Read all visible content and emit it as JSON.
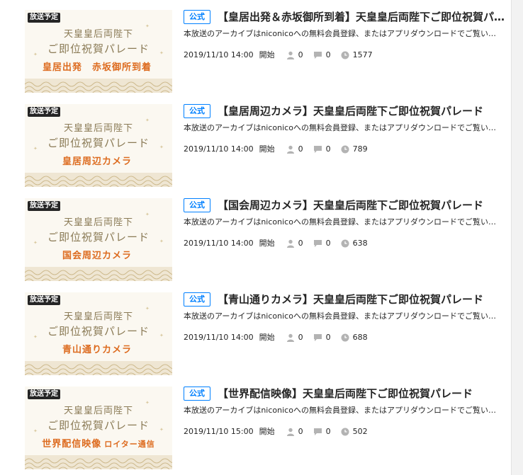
{
  "colors": {
    "official_blue": "#0080ff",
    "badge_bg": "#252525",
    "thumb_orange": "#dd6b1f",
    "thumb_gold": "#8a7a55",
    "meta_icon": "#b3b3b3"
  },
  "programs": [
    {
      "badge": "放送予定",
      "thumb_line1": "天皇皇后両陛下",
      "thumb_line2": "ご即位祝賀パレード",
      "thumb_line3": "皇居出発　赤坂御所到着",
      "thumb_line3_sub": "",
      "official": "公式",
      "title": "【皇居出発＆赤坂御所到着】天皇皇后両陛下ご即位祝賀パレード",
      "description": "本放送のアーカイブはniconicoへの無料会員登録、またはアプリダウンロードでご覧いただけます。",
      "date": "2019/11/10 14:00",
      "start_label": "開始",
      "viewers": "0",
      "comments": "0",
      "reservations": "1577",
      "icons": [
        "person-icon",
        "comment-icon",
        "clock-icon"
      ]
    },
    {
      "badge": "放送予定",
      "thumb_line1": "天皇皇后両陛下",
      "thumb_line2": "ご即位祝賀パレード",
      "thumb_line3": "皇居周辺カメラ",
      "thumb_line3_sub": "",
      "official": "公式",
      "title": "【皇居周辺カメラ】天皇皇后両陛下ご即位祝賀パレード",
      "description": "本放送のアーカイブはniconicoへの無料会員登録、またはアプリダウンロードでご覧いただけます。",
      "date": "2019/11/10 14:00",
      "start_label": "開始",
      "viewers": "0",
      "comments": "0",
      "reservations": "789",
      "icons": [
        "person-icon",
        "comment-icon",
        "clock-icon"
      ]
    },
    {
      "badge": "放送予定",
      "thumb_line1": "天皇皇后両陛下",
      "thumb_line2": "ご即位祝賀パレード",
      "thumb_line3": "国会周辺カメラ",
      "thumb_line3_sub": "",
      "official": "公式",
      "title": "【国会周辺カメラ】天皇皇后両陛下ご即位祝賀パレード",
      "description": "本放送のアーカイブはniconicoへの無料会員登録、またはアプリダウンロードでご覧いただけます。",
      "date": "2019/11/10 14:00",
      "start_label": "開始",
      "viewers": "0",
      "comments": "0",
      "reservations": "638",
      "icons": [
        "person-icon",
        "comment-icon",
        "clock-icon"
      ]
    },
    {
      "badge": "放送予定",
      "thumb_line1": "天皇皇后両陛下",
      "thumb_line2": "ご即位祝賀パレード",
      "thumb_line3": "青山通りカメラ",
      "thumb_line3_sub": "",
      "official": "公式",
      "title": "【青山通りカメラ】天皇皇后両陛下ご即位祝賀パレード",
      "description": "本放送のアーカイブはniconicoへの無料会員登録、またはアプリダウンロードでご覧いただけます。",
      "date": "2019/11/10 14:00",
      "start_label": "開始",
      "viewers": "0",
      "comments": "0",
      "reservations": "688",
      "icons": [
        "person-icon",
        "comment-icon",
        "clock-icon"
      ]
    },
    {
      "badge": "放送予定",
      "thumb_line1": "天皇皇后両陛下",
      "thumb_line2": "ご即位祝賀パレード",
      "thumb_line3": "世界配信映像",
      "thumb_line3_sub": "ロイター通信",
      "official": "公式",
      "title": "【世界配信映像】天皇皇后両陛下ご即位祝賀パレード",
      "description": "本放送のアーカイブはniconicoへの無料会員登録、またはアプリダウンロードでご覧いただけます。",
      "date": "2019/11/10 15:00",
      "start_label": "開始",
      "viewers": "0",
      "comments": "0",
      "reservations": "502",
      "icons": [
        "person-icon",
        "comment-icon",
        "clock-icon"
      ]
    }
  ]
}
